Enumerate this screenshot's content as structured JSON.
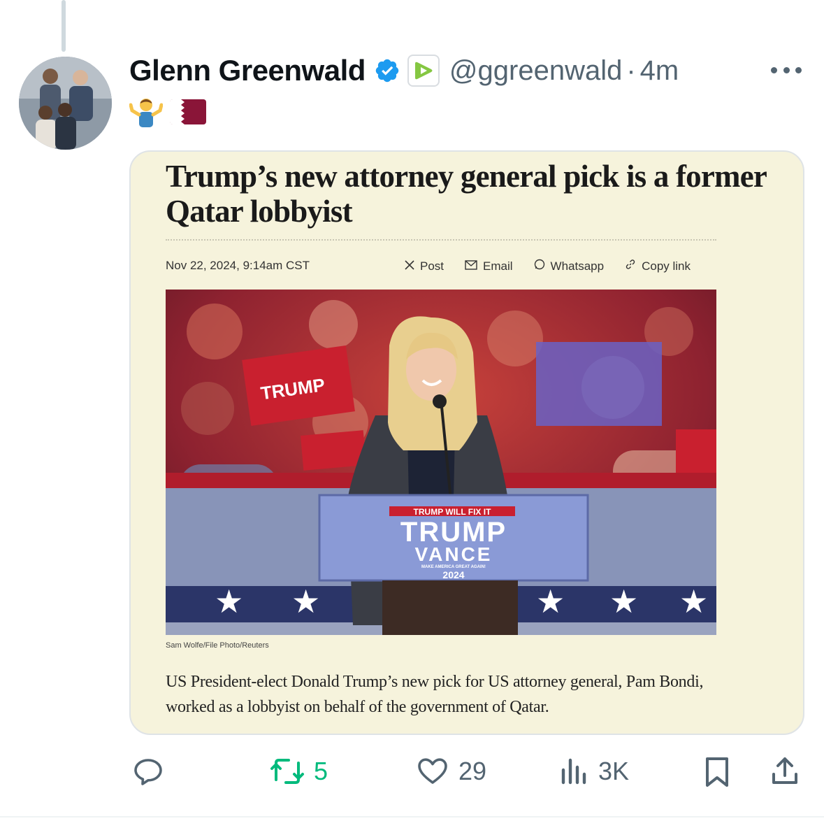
{
  "tweet": {
    "author_name": "Glenn Greenwald",
    "handle": "@ggreenwald",
    "separator": "·",
    "time": "4m",
    "text_emojis": [
      "🤷‍♂️",
      "🇶🇦"
    ]
  },
  "article": {
    "title": "Trump’s new attorney general pick is a former Qatar lobbyist",
    "date": "Nov 22, 2024, 9:14am CST",
    "share_links": [
      {
        "icon": "x-logo-icon",
        "label": "Post"
      },
      {
        "icon": "mail-icon",
        "label": "Email"
      },
      {
        "icon": "whatsapp-icon",
        "label": "Whatsapp"
      },
      {
        "icon": "link-icon",
        "label": "Copy link"
      }
    ],
    "photo": {
      "podium_banner": "TRUMP WILL FIX IT",
      "podium_line1": "TRUMP",
      "podium_line2": "VANCE",
      "podium_slogan": "MAKE AMERICA GREAT AGAIN!",
      "podium_year": "2024",
      "sign_text": "TRUMP"
    },
    "credit": "Sam Wolfe/File Photo/Reuters",
    "description": "US President-elect Donald Trump’s new pick for US attorney general, Pam Bondi, worked as a lobbyist on behalf of the government of Qatar."
  },
  "actions": {
    "reply": {
      "icon": "reply-icon",
      "count": ""
    },
    "retweet": {
      "icon": "retweet-icon",
      "count": "5"
    },
    "like": {
      "icon": "heart-icon",
      "count": "29"
    },
    "views": {
      "icon": "views-icon",
      "count": "3K"
    },
    "bookmark": {
      "icon": "bookmark-icon"
    },
    "share": {
      "icon": "share-icon"
    }
  },
  "colors": {
    "verified": "#1d9bf0",
    "retweet_active": "#00ba7c",
    "secondary_text": "#536471",
    "card_bg": "#f6f3dc"
  }
}
